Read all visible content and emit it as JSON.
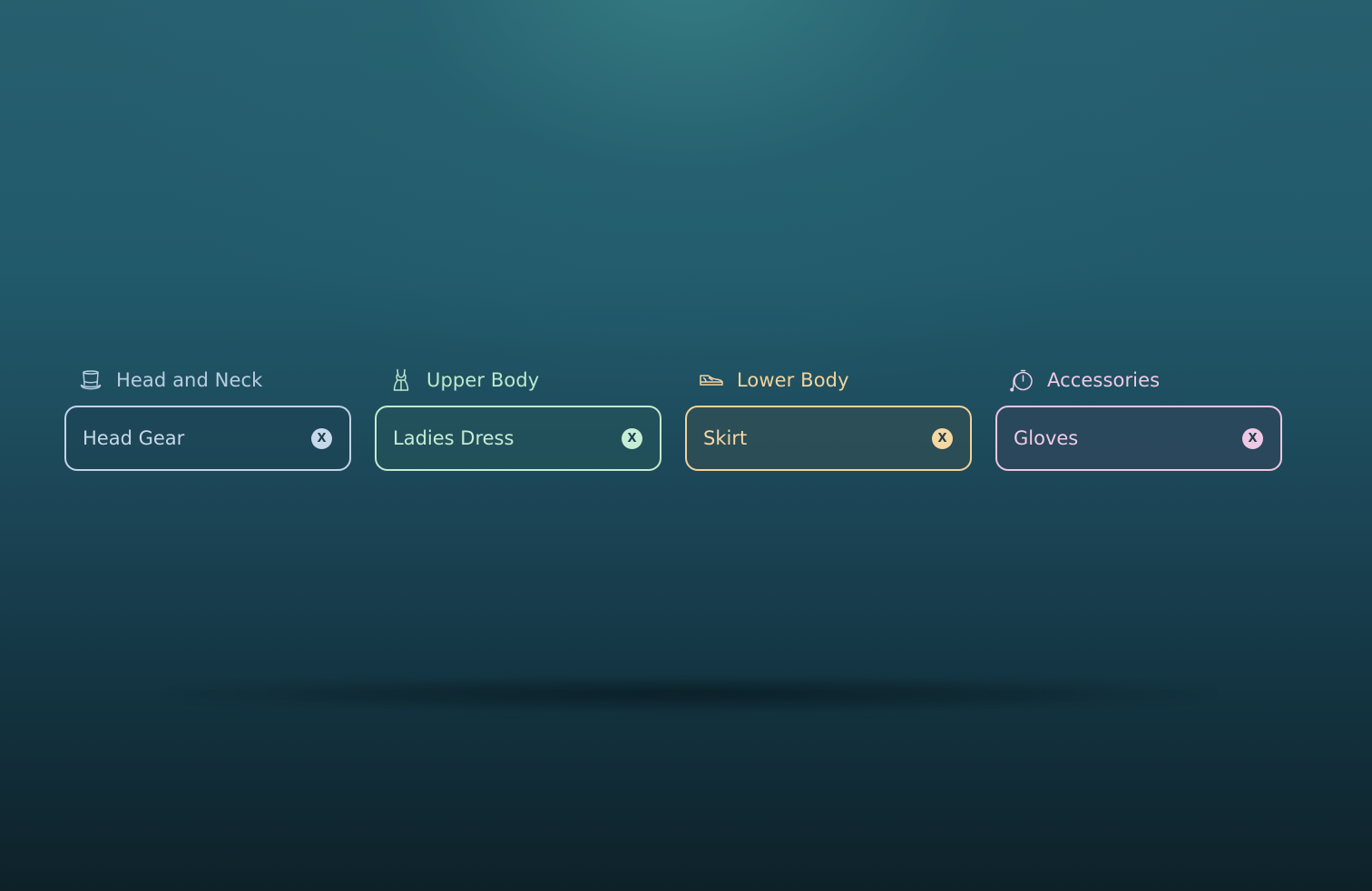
{
  "groups": [
    {
      "label": "Head and Neck",
      "icon": "top-hat-icon",
      "value": "Head Gear",
      "clear_glyph": "X",
      "accent": "#c1d4e6"
    },
    {
      "label": "Upper Body",
      "icon": "dress-icon",
      "value": "Ladies Dress",
      "clear_glyph": "X",
      "accent": "#c3ebd1"
    },
    {
      "label": "Lower Body",
      "icon": "shoe-icon",
      "value": "Skirt",
      "clear_glyph": "X",
      "accent": "#f2d29b"
    },
    {
      "label": "Accessories",
      "icon": "watch-icon",
      "value": "Gloves",
      "clear_glyph": "X",
      "accent": "#edc5e2"
    }
  ]
}
